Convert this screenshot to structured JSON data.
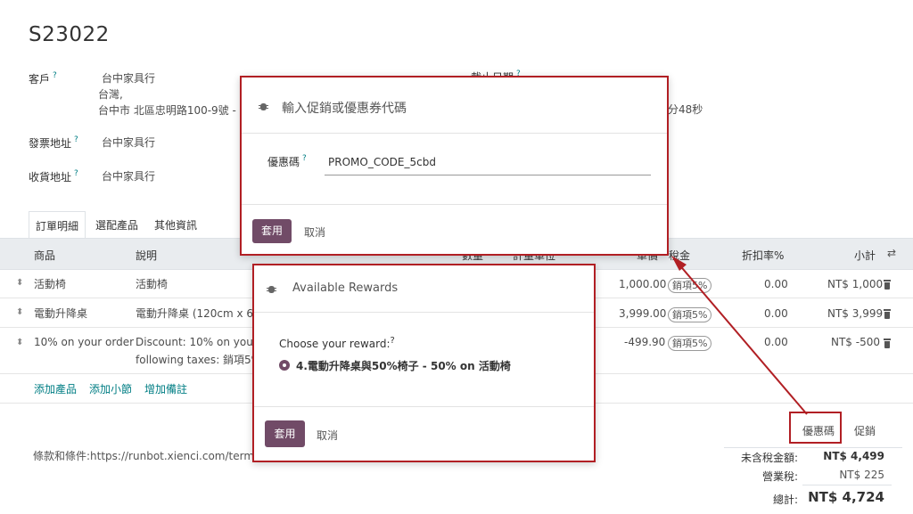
{
  "order": {
    "name": "S23022",
    "customer_label": "客戶",
    "customer_name": "台中家具行",
    "customer_addr1": "台灣,",
    "customer_addr2": "台中市 北區忠明路100-9號 -",
    "invoice_label": "發票地址",
    "invoice_value": "台中家具行",
    "shipping_label": "收貨地址",
    "shipping_value": "台中家具行",
    "deadline_label": "截止日期",
    "deadline_partial": "分48秒",
    "hint": "?"
  },
  "tabs": [
    {
      "label": "訂單明細",
      "active": true
    },
    {
      "label": "選配產品",
      "active": false
    },
    {
      "label": "其他資訊",
      "active": false
    }
  ],
  "table": {
    "headers": {
      "product": "商品",
      "description": "說明",
      "quantity": "數量",
      "uom": "計量單位",
      "price": "單價",
      "tax": "稅金",
      "discount": "折扣率%",
      "subtotal": "小計"
    },
    "rows": [
      {
        "product": "活動椅",
        "description": "活動椅",
        "description2": "",
        "price": "1,000.00",
        "tax": "銷項5%",
        "discount": "0.00",
        "subtotal": "NT$ 1,000"
      },
      {
        "product": "電動升降桌",
        "description": "電動升降桌 (120cm x 60",
        "description2": "",
        "price": "3,999.00",
        "tax": "銷項5%",
        "discount": "0.00",
        "subtotal": "NT$ 3,999"
      },
      {
        "product": "10% on your order",
        "description": "Discount: 10% on your c",
        "description2": "following taxes: 銷項5%",
        "price": "-499.90",
        "tax": "銷項5%",
        "discount": "0.00",
        "subtotal": "NT$ -500"
      }
    ],
    "add_product": "添加產品",
    "add_section": "添加小節",
    "add_note": "增加備註"
  },
  "terms": "條款和條件:https://runbot.xienci.com/terms",
  "footer_buttons": {
    "coupon": "優惠碼",
    "promotion": "促銷"
  },
  "summary": {
    "untaxed_label": "未含稅金額:",
    "untaxed_value": "NT$ 4,499",
    "tax_label": "營業稅:",
    "tax_value": "NT$ 225",
    "total_label": "總計:",
    "total_value": "NT$ 4,724"
  },
  "coupon_dialog": {
    "title": "輸入促銷或優惠券代碼",
    "field_label": "優惠碼",
    "field_value": "PROMO_CODE_5cbd",
    "apply": "套用",
    "cancel": "取消"
  },
  "rewards_dialog": {
    "title": "Available Rewards",
    "choose_label": "Choose your reward:",
    "reward_option": "4.電動升降桌與50%椅子 - 50% on 活動椅",
    "apply": "套用",
    "cancel": "取消"
  },
  "colors": {
    "primary": "#714b67",
    "highlight_red": "#b11f24",
    "hint": "#017e84"
  }
}
